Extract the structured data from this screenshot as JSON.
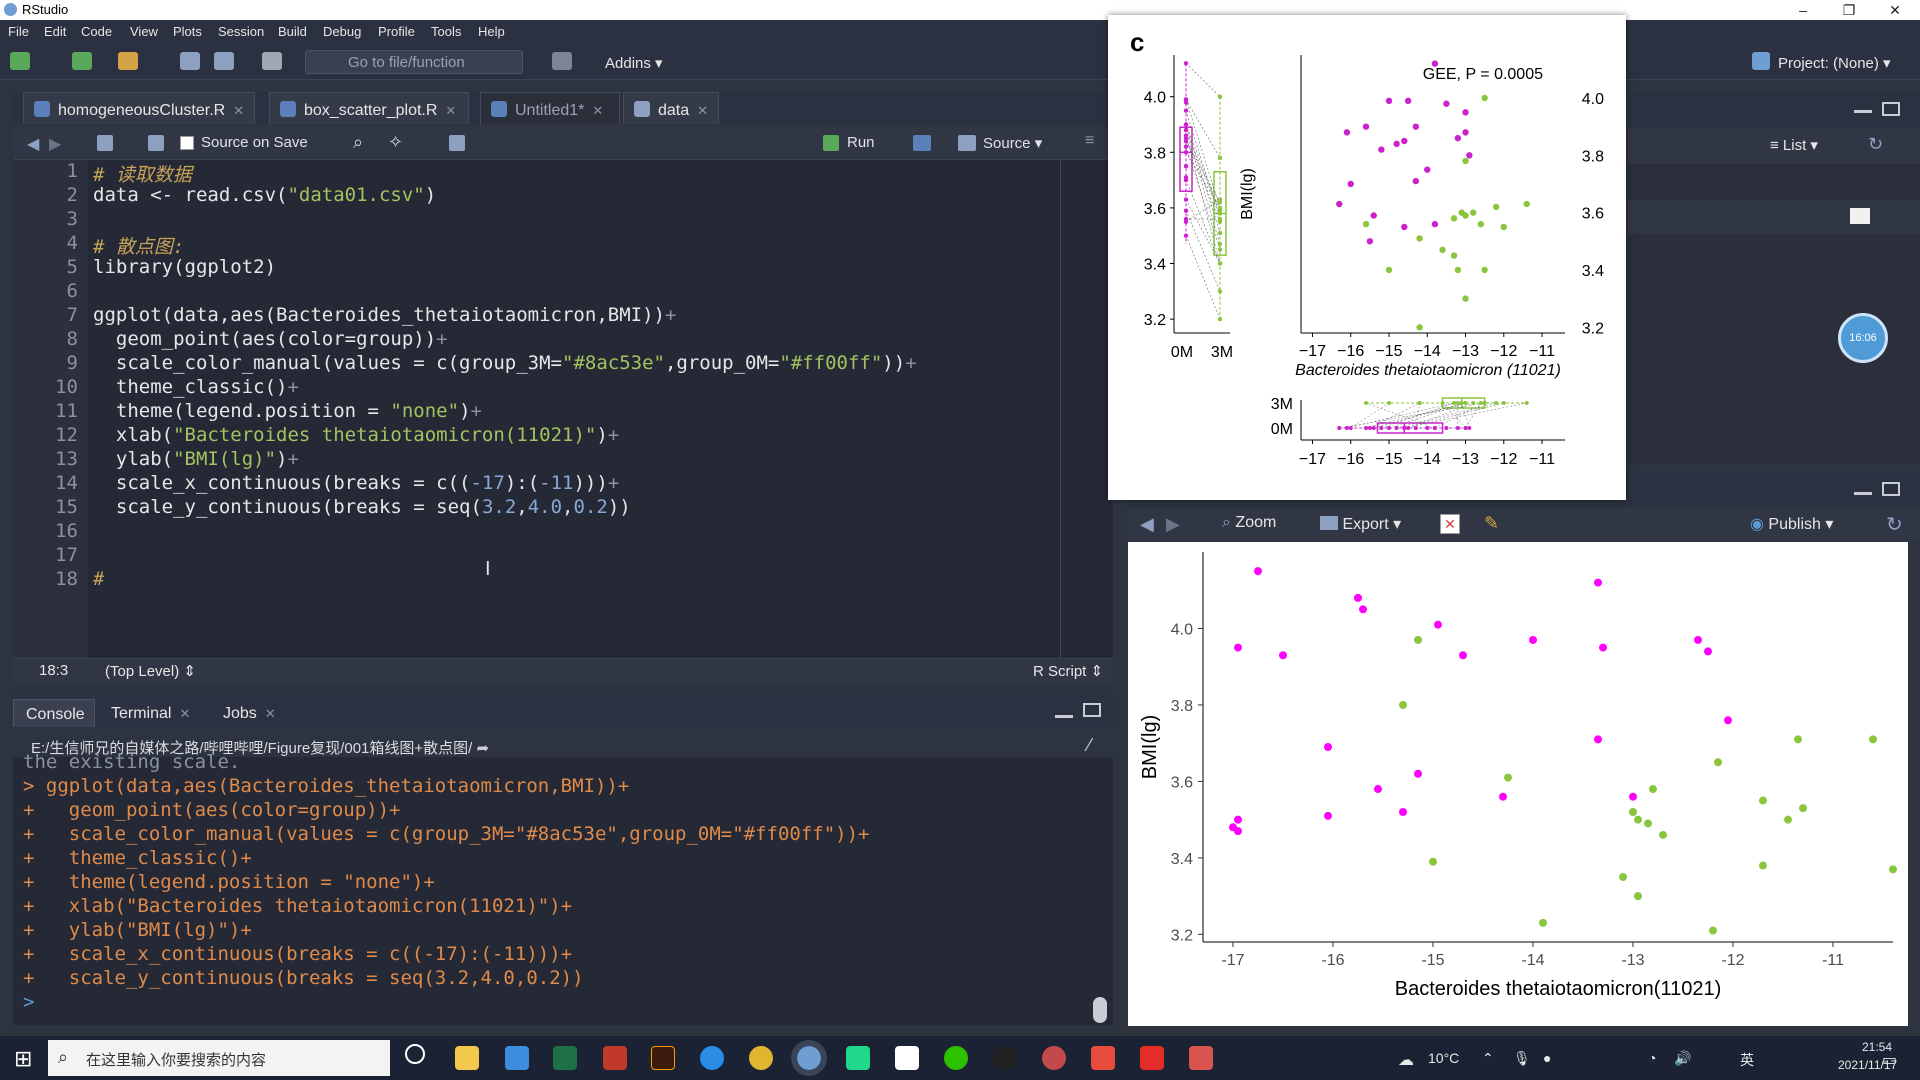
{
  "window": {
    "title": "RStudio",
    "controls": {
      "minimize": "–",
      "maximize": "❐",
      "close": "✕"
    }
  },
  "menu": [
    "File",
    "Edit",
    "Code",
    "View",
    "Plots",
    "Session",
    "Build",
    "Debug",
    "Profile",
    "Tools",
    "Help"
  ],
  "toolbar": {
    "goto_placeholder": "Go to file/function",
    "addins": "Addins",
    "project": "Project: (None)"
  },
  "editor": {
    "tabs": [
      {
        "label": "homogeneousCluster.R"
      },
      {
        "label": "box_scatter_plot.R"
      },
      {
        "label": "Untitled1*"
      },
      {
        "label": "data"
      }
    ],
    "toolbar": {
      "source_on_save": "Source on Save",
      "run": "Run",
      "source": "Source"
    },
    "lines": [
      {
        "n": "1"
      },
      {
        "n": "2"
      },
      {
        "n": "3"
      },
      {
        "n": "4"
      },
      {
        "n": "5"
      },
      {
        "n": "6"
      },
      {
        "n": "7"
      },
      {
        "n": "8"
      },
      {
        "n": "9"
      },
      {
        "n": "10"
      },
      {
        "n": "11"
      },
      {
        "n": "12"
      },
      {
        "n": "13"
      },
      {
        "n": "14"
      },
      {
        "n": "15"
      },
      {
        "n": "16"
      },
      {
        "n": "17"
      },
      {
        "n": "18"
      }
    ],
    "code": {
      "l1": "# 读取数据",
      "l2a": "data <- read.csv(",
      "l2b": "\"data01.csv\"",
      "l2c": ")",
      "l4": "# 散点图:",
      "l5": "library(ggplot2)",
      "l7a": "ggplot(data,aes(Bacteroides_thetaiotaomicron,BMI))",
      "l7b": "+",
      "l8a": "  geom_point(aes(color=group))",
      "l8b": "+",
      "l9a": "  scale_color_manual(values = c(group_3M=",
      "l9b": "\"#8ac53e\"",
      "l9c": ",group_0M=",
      "l9d": "\"#ff00ff\"",
      "l9e": "))",
      "l9f": "+",
      "l10a": "  theme_classic()",
      "l10b": "+",
      "l11a": "  theme(legend.position = ",
      "l11b": "\"none\"",
      "l11c": ")",
      "l11d": "+",
      "l12a": "  xlab(",
      "l12b": "\"Bacteroides thetaiotaomicron(11021)\"",
      "l12c": ")",
      "l12d": "+",
      "l13a": "  ylab(",
      "l13b": "\"BMI(lg)\"",
      "l13c": ")",
      "l13d": "+",
      "l14a": "  scale_x_continuous(breaks = c((",
      "l14b": "-17",
      "l14c": "):(",
      "l14d": "-11",
      "l14e": ")))",
      "l14f": "+",
      "l15a": "  scale_y_continuous(breaks = seq(",
      "l15b": "3.2",
      "l15c": ",",
      "l15d": "4.0",
      "l15e": ",",
      "l15f": "0.2",
      "l15g": "))",
      "l18": "#"
    },
    "status": {
      "position": "18:3",
      "scope": "(Top Level)",
      "filetype": "R Script"
    }
  },
  "console": {
    "tabs": [
      {
        "label": "Console"
      },
      {
        "label": "Terminal"
      },
      {
        "label": "Jobs"
      }
    ],
    "path": "E:/生信师兄的自媒体之路/哔哩哔哩/Figure复现/001箱线图+散点图/",
    "lines": [
      "the existing scale.",
      "> ggplot(data,aes(Bacteroides_thetaiotaomicron,BMI))+",
      "+   geom_point(aes(color=group))+",
      "+   scale_color_manual(values = c(group_3M=\"#8ac53e\",group_0M=\"#ff00ff\"))+",
      "+   theme_classic()+",
      "+   theme(legend.position = \"none\")+",
      "+   xlab(\"Bacteroides thetaiotaomicron(11021)\")+",
      "+   ylab(\"BMI(lg)\")+",
      "+   scale_x_continuous(breaks = c((-17):(-11)))+",
      "+   scale_y_continuous(breaks = seq(3.2,4.0,0.2))",
      "> "
    ]
  },
  "environment": {
    "view_mode": "List"
  },
  "clock_badge": "16:06",
  "plots": {
    "toolbar": {
      "zoom": "Zoom",
      "export": "Export",
      "publish": "Publish"
    }
  },
  "colors": {
    "group_3M": "#8ac53e",
    "group_0M": "#ff00ff"
  },
  "chart_data": [
    {
      "type": "scatter",
      "panel": "plots-pane",
      "title": "",
      "xlabel": "Bacteroides thetaiotaomicron(11021)",
      "ylabel": "BMI(lg)",
      "xlim": [
        -17.3,
        -10.4
      ],
      "ylim": [
        3.18,
        4.2
      ],
      "xticks": [
        -17,
        -16,
        -15,
        -14,
        -13,
        -12,
        -11
      ],
      "xtick_labels": [
        "-17",
        "-16",
        "-15",
        "-14",
        "-13",
        "-12",
        "-11"
      ],
      "yticks": [
        3.2,
        3.4,
        3.6,
        3.8,
        4.0
      ],
      "ytick_labels": [
        "3.2",
        "3.4",
        "3.6",
        "3.8",
        "4.0"
      ],
      "grid": false,
      "legend": "none",
      "series": [
        {
          "name": "group_0M",
          "color": "#ff00ff",
          "points": [
            [
              -16.75,
              4.15
            ],
            [
              -16.95,
              3.95
            ],
            [
              -16.5,
              3.93
            ],
            [
              -15.75,
              4.08
            ],
            [
              -15.7,
              4.05
            ],
            [
              -16.05,
              3.69
            ],
            [
              -15.55,
              3.58
            ],
            [
              -15.3,
              3.52
            ],
            [
              -15.15,
              3.62
            ],
            [
              -16.05,
              3.51
            ],
            [
              -14.95,
              4.01
            ],
            [
              -14.7,
              3.93
            ],
            [
              -14.0,
              3.97
            ],
            [
              -13.35,
              4.12
            ],
            [
              -13.3,
              3.95
            ],
            [
              -13.35,
              3.71
            ],
            [
              -14.3,
              3.56
            ],
            [
              -12.35,
              3.97
            ],
            [
              -12.25,
              3.94
            ],
            [
              -12.05,
              3.76
            ],
            [
              -17.0,
              3.48
            ],
            [
              -16.95,
              3.5
            ],
            [
              -16.95,
              3.47
            ],
            [
              -13.0,
              3.56
            ]
          ]
        },
        {
          "name": "group_3M",
          "color": "#8ac53e",
          "points": [
            [
              -15.3,
              3.8
            ],
            [
              -15.15,
              3.97
            ],
            [
              -14.25,
              3.61
            ],
            [
              -15.0,
              3.39
            ],
            [
              -13.9,
              3.23
            ],
            [
              -13.0,
              3.52
            ],
            [
              -12.95,
              3.5
            ],
            [
              -12.85,
              3.49
            ],
            [
              -12.8,
              3.58
            ],
            [
              -12.7,
              3.46
            ],
            [
              -13.1,
              3.35
            ],
            [
              -12.95,
              3.3
            ],
            [
              -12.15,
              3.65
            ],
            [
              -12.2,
              3.21
            ],
            [
              -11.7,
              3.55
            ],
            [
              -11.45,
              3.5
            ],
            [
              -11.3,
              3.53
            ],
            [
              -11.35,
              3.71
            ],
            [
              -11.7,
              3.38
            ],
            [
              -10.6,
              3.71
            ],
            [
              -10.4,
              3.37
            ]
          ]
        }
      ]
    },
    {
      "type": "scatter",
      "panel": "overlay-figure-main",
      "title": "GEE, P = 0.0005",
      "panel_label": "c",
      "xlabel": "Bacteroides thetaiotaomicron (11021)",
      "ylabel": "BMI(lg)",
      "xlim": [
        -17.3,
        -10.4
      ],
      "ylim": [
        3.18,
        4.15
      ],
      "xticks": [
        -17,
        -16,
        -15,
        -14,
        -13,
        -12,
        -11
      ],
      "xtick_labels": [
        "−17",
        "−16",
        "−15",
        "−14",
        "−13",
        "−12",
        "−11"
      ],
      "yticks": [
        3.2,
        3.4,
        3.6,
        3.8,
        4.0
      ],
      "ytick_labels": [
        "3.2",
        "3.4",
        "3.6",
        "3.8",
        "4.0"
      ],
      "right_ytick_labels": [
        "3.2",
        "3.4",
        "3.6",
        "3.8",
        "4.0"
      ],
      "series": [
        {
          "name": "0M",
          "color": "#cc22cc",
          "points": [
            [
              -13.8,
              4.12
            ],
            [
              -15.0,
              3.99
            ],
            [
              -14.5,
              3.99
            ],
            [
              -16.1,
              3.88
            ],
            [
              -15.6,
              3.9
            ],
            [
              -14.3,
              3.9
            ],
            [
              -13.0,
              3.88
            ],
            [
              -15.2,
              3.82
            ],
            [
              -14.8,
              3.84
            ],
            [
              -14.6,
              3.85
            ],
            [
              -13.2,
              3.86
            ],
            [
              -16.3,
              3.63
            ],
            [
              -15.4,
              3.59
            ],
            [
              -15.5,
              3.5
            ],
            [
              -16.0,
              3.7
            ],
            [
              -14.6,
              3.55
            ],
            [
              -13.8,
              3.56
            ],
            [
              -12.9,
              3.8
            ],
            [
              -13.0,
              3.95
            ],
            [
              -14.3,
              3.71
            ],
            [
              -13.5,
              3.98
            ],
            [
              -14.0,
              3.75
            ]
          ]
        },
        {
          "name": "3M",
          "color": "#8ac53e",
          "points": [
            [
              -12.5,
              4.0
            ],
            [
              -13.0,
              3.78
            ],
            [
              -12.8,
              3.6
            ],
            [
              -13.3,
              3.58
            ],
            [
              -13.0,
              3.59
            ],
            [
              -14.2,
              3.51
            ],
            [
              -13.6,
              3.47
            ],
            [
              -13.3,
              3.45
            ],
            [
              -12.2,
              3.62
            ],
            [
              -12.0,
              3.55
            ],
            [
              -13.2,
              3.4
            ],
            [
              -12.5,
              3.4
            ],
            [
              -13.0,
              3.3
            ],
            [
              -14.2,
              3.2
            ],
            [
              -15.0,
              3.4
            ],
            [
              -11.4,
              3.63
            ],
            [
              -15.6,
              3.56
            ],
            [
              -13.1,
              3.6
            ],
            [
              -12.6,
              3.56
            ]
          ]
        }
      ]
    },
    {
      "type": "box",
      "panel": "overlay-figure-left",
      "categories": [
        "0M",
        "3M"
      ],
      "yticks": [
        3.2,
        3.4,
        3.6,
        3.8,
        4.0
      ],
      "ytick_labels": [
        "3.2",
        "3.4",
        "3.6",
        "3.8",
        "4.0"
      ],
      "series": [
        {
          "name": "0M",
          "color": "#cc22cc",
          "q1": 3.66,
          "median": 3.8,
          "q3": 3.89,
          "min": 3.47,
          "max": 4.12
        },
        {
          "name": "3M",
          "color": "#8ac53e",
          "q1": 3.43,
          "median": 3.58,
          "q3": 3.73,
          "min": 3.2,
          "max": 4.0
        }
      ]
    },
    {
      "type": "box",
      "panel": "overlay-figure-bottom",
      "orientation": "horizontal",
      "categories": [
        "0M",
        "3M"
      ],
      "category_labels": [
        "0M",
        "3M"
      ],
      "xticks": [
        -17,
        -16,
        -15,
        -14,
        -13,
        -12,
        -11
      ],
      "xtick_labels": [
        "−17",
        "−16",
        "−15",
        "−14",
        "−13",
        "−12",
        "−11"
      ],
      "series": [
        {
          "name": "0M",
          "color": "#cc22cc",
          "q1": -15.3,
          "median": -14.6,
          "q3": -13.6,
          "min": -16.3,
          "max": -12.9
        },
        {
          "name": "3M",
          "color": "#8ac53e",
          "q1": -13.6,
          "median": -13.1,
          "q3": -12.5,
          "min": -15.6,
          "max": -11.4
        }
      ]
    }
  ],
  "taskbar": {
    "search_placeholder": "在这里输入你要搜索的内容",
    "weather": "10°C",
    "ime": "英",
    "time": "21:54",
    "date": "2021/11/17"
  }
}
